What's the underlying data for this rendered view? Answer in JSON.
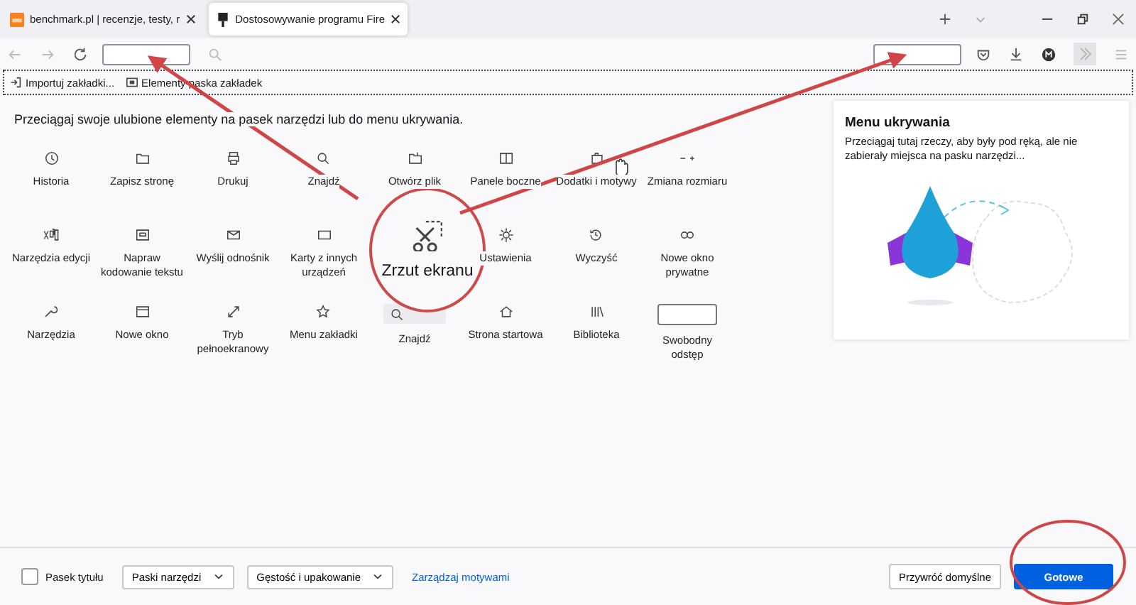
{
  "tabs": [
    {
      "title": "benchmark.pl | recenzje, testy, r",
      "selected": false
    },
    {
      "title": "Dostosowywanie programu Fire",
      "selected": true
    }
  ],
  "bookmarks_toolbar": [
    "Importuj zakładki...",
    "Elementy paska zakładek"
  ],
  "instructions": "Przeciągaj swoje ulubione elementy na pasek narzędzi lub do menu ukrywania.",
  "palette": [
    {
      "label": "Historia",
      "kind": "button"
    },
    {
      "label": "Zapisz stronę",
      "kind": "button"
    },
    {
      "label": "Drukuj",
      "kind": "button"
    },
    {
      "label": "Znajdź",
      "kind": "button"
    },
    {
      "label": "Otwórz plik",
      "kind": "button"
    },
    {
      "label": "Panele boczne",
      "kind": "button"
    },
    {
      "label": "Dodatki i motywy",
      "kind": "button"
    },
    {
      "label": "Zmiana rozmiaru",
      "kind": "button"
    },
    {
      "label": "Narzędzia edycji",
      "kind": "button"
    },
    {
      "label": "Napraw kodowanie tekstu",
      "kind": "button"
    },
    {
      "label": "Wyślij odnośnik",
      "kind": "button"
    },
    {
      "label": "Karty z innych urządzeń",
      "kind": "button"
    },
    {
      "label": "Zrzut ekranu",
      "kind": "magnified"
    },
    {
      "label": "Ustawienia",
      "kind": "button"
    },
    {
      "label": "Wyczyść",
      "kind": "button"
    },
    {
      "label": "Nowe okno prywatne",
      "kind": "button"
    },
    {
      "label": "Narzędzia",
      "kind": "button"
    },
    {
      "label": "Nowe okno",
      "kind": "button"
    },
    {
      "label": "Tryb pełnoekranowy",
      "kind": "button"
    },
    {
      "label": "Menu zakładki",
      "kind": "button"
    },
    {
      "label": "Znajdź",
      "kind": "search-field"
    },
    {
      "label": "Strona startowa",
      "kind": "button"
    },
    {
      "label": "Biblioteka",
      "kind": "button"
    },
    {
      "label": "Swobodny odstęp",
      "kind": "spacer"
    }
  ],
  "overflow_panel": {
    "title": "Menu ukrywania",
    "text": "Przeciągaj tutaj rzeczy, aby były pod ręką, ale nie zabierały miejsca na pasku narzędzi..."
  },
  "footer": {
    "title_bar": {
      "label": "Pasek tytułu",
      "checked": false
    },
    "toolbars": "Paski narzędzi",
    "density": "Gęstość i upakowanie",
    "themes_link": "Zarządzaj motywami",
    "restore": "Przywróć domyślne",
    "done": "Gotowe"
  }
}
